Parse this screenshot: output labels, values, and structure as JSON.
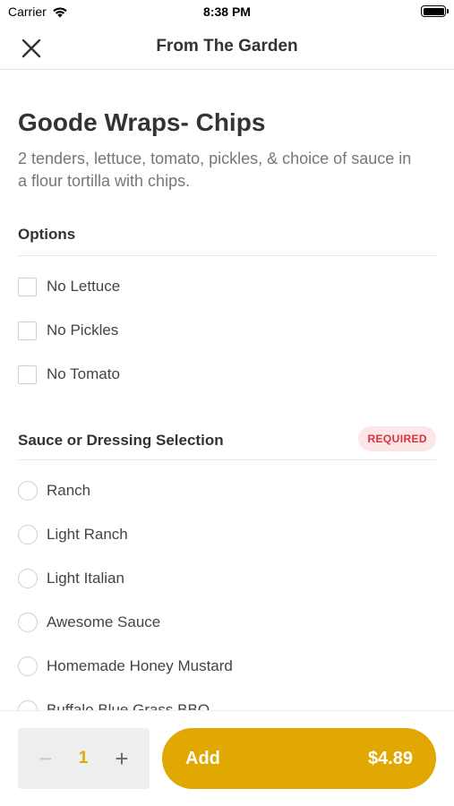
{
  "status_bar": {
    "carrier": "Carrier",
    "time": "8:38 PM"
  },
  "nav": {
    "title": "From The Garden",
    "close_icon": "close-icon"
  },
  "item": {
    "title": "Goode Wraps- Chips",
    "description": "2 tenders, lettuce, tomato, pickles, & choice of sauce in a flour tortilla with chips."
  },
  "options": {
    "title": "Options",
    "items": [
      {
        "label": "No Lettuce",
        "checked": false
      },
      {
        "label": "No Pickles",
        "checked": false
      },
      {
        "label": "No Tomato",
        "checked": false
      }
    ]
  },
  "sauce": {
    "title": "Sauce or Dressing Selection",
    "badge": "REQUIRED",
    "items": [
      {
        "label": "Ranch",
        "selected": false
      },
      {
        "label": "Light Ranch",
        "selected": false
      },
      {
        "label": "Light Italian",
        "selected": false
      },
      {
        "label": "Awesome Sauce",
        "selected": false
      },
      {
        "label": "Homemade Honey Mustard",
        "selected": false
      },
      {
        "label": "Buffalo Blue Grass BBQ",
        "selected": false
      }
    ]
  },
  "footer": {
    "quantity": "1",
    "minus_symbol": "−",
    "plus_symbol": "+",
    "add_label": "Add",
    "price": "$4.89"
  },
  "colors": {
    "accent": "#e0a800",
    "required_bg": "#fde6e8",
    "required_text": "#d6323c"
  }
}
